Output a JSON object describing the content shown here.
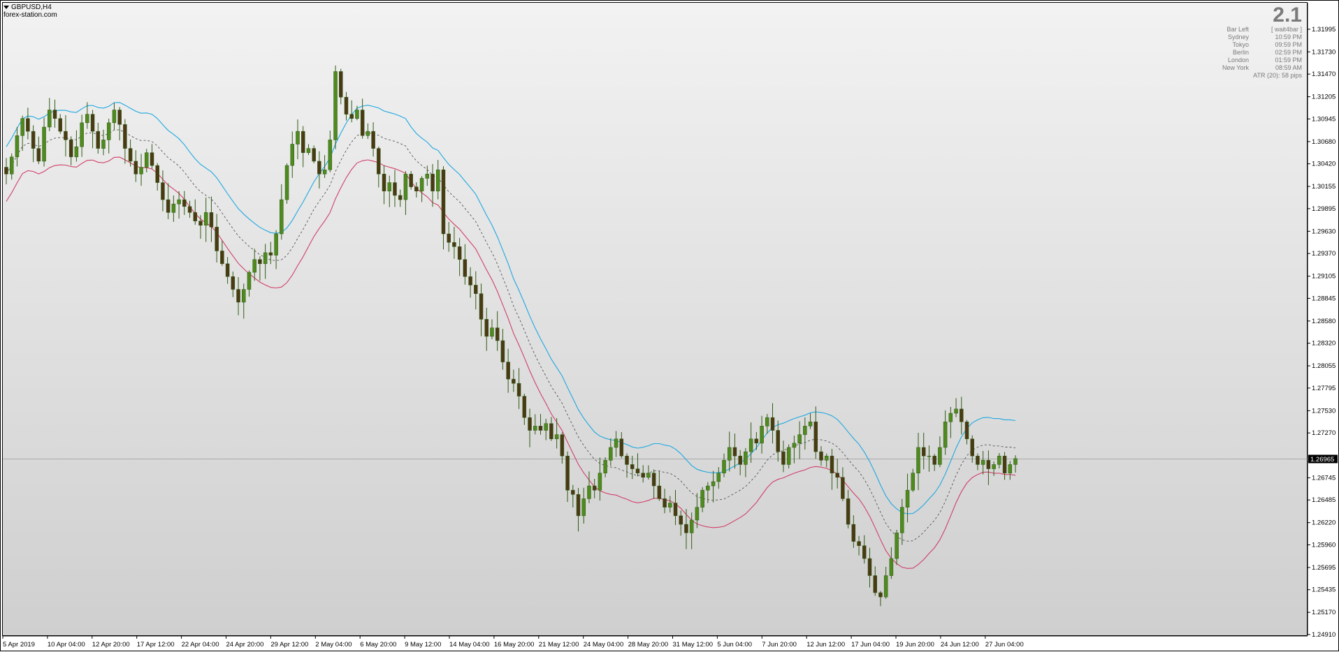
{
  "chart_header": {
    "symbol_label": "GBPUSD,H4",
    "source_label": "forex-station.com"
  },
  "info_panel": {
    "big_value": "2.1",
    "rows": [
      {
        "label": "Bar Left",
        "value": "[ wait4bar ]"
      },
      {
        "label": "Sydney",
        "value": "10:59 PM"
      },
      {
        "label": "Tokyo",
        "value": "09:59 PM"
      },
      {
        "label": "Berlin",
        "value": "02:59 PM"
      },
      {
        "label": "London",
        "value": "01:59 PM"
      },
      {
        "label": "New York",
        "value": "08:59 AM"
      }
    ],
    "atr": "ATR (20): 58 pips"
  },
  "colors": {
    "bull_body": "#4f8a1f",
    "bear_body": "#4a3a14",
    "wick": "#2f5a12",
    "upper_band": "#1ea8e0",
    "lower_band": "#d0406a",
    "middle_line": "#555555",
    "current_price_bg": "#000000"
  },
  "current_price": "1.26965",
  "chart_data": {
    "type": "candlestick",
    "symbol": "GBPUSD",
    "timeframe": "H4",
    "ylim": [
      1.2491,
      1.3219
    ],
    "price_ticks": [
      "1.31995",
      "1.31730",
      "1.31470",
      "1.31205",
      "1.30945",
      "1.30680",
      "1.30420",
      "1.30155",
      "1.29895",
      "1.29630",
      "1.29370",
      "1.29105",
      "1.28845",
      "1.28580",
      "1.28320",
      "1.28055",
      "1.27795",
      "1.27530",
      "1.27270",
      "1.26745",
      "1.26485",
      "1.26220",
      "1.25960",
      "1.25695",
      "1.25435",
      "1.25170",
      "1.24910"
    ],
    "time_ticks": [
      "5 Apr 2019",
      "10 Apr 04:00",
      "12 Apr 20:00",
      "17 Apr 12:00",
      "22 Apr 04:00",
      "24 Apr 20:00",
      "29 Apr 12:00",
      "2 May 04:00",
      "6 May 20:00",
      "9 May 12:00",
      "14 May 04:00",
      "16 May 20:00",
      "21 May 12:00",
      "24 May 04:00",
      "28 May 20:00",
      "31 May 12:00",
      "5 Jun 04:00",
      "7 Jun 20:00",
      "12 Jun 12:00",
      "17 Jun 04:00",
      "19 Jun 20:00",
      "24 Jun 12:00",
      "27 Jun 04:00"
    ],
    "close_path": [
      1.303,
      1.305,
      1.3075,
      1.3095,
      1.308,
      1.306,
      1.3045,
      1.3085,
      1.3105,
      1.3095,
      1.308,
      1.307,
      1.305,
      1.3062,
      1.309,
      1.31,
      1.308,
      1.306,
      1.307,
      1.309,
      1.3105,
      1.3088,
      1.306,
      1.3045,
      1.303,
      1.3038,
      1.3055,
      1.304,
      1.302,
      1.3,
      1.2985,
      1.2995,
      1.3,
      1.2992,
      1.2985,
      1.2975,
      1.297,
      1.2985,
      1.2968,
      1.294,
      1.2925,
      1.291,
      1.2895,
      1.288,
      1.2895,
      1.2915,
      1.293,
      1.2925,
      1.2938,
      1.2935,
      1.296,
      1.3,
      1.304,
      1.3065,
      1.308,
      1.3055,
      1.306,
      1.3045,
      1.303,
      1.3035,
      1.307,
      1.315,
      1.312,
      1.31,
      1.3095,
      1.3105,
      1.3075,
      1.308,
      1.306,
      1.303,
      1.301,
      1.302,
      1.3005,
      1.3,
      1.303,
      1.3015,
      1.301,
      1.3025,
      1.303,
      1.301,
      1.3035,
      1.296,
      1.295,
      1.2945,
      1.293,
      1.291,
      1.29,
      1.289,
      1.286,
      1.284,
      1.285,
      1.2835,
      1.281,
      1.279,
      1.2785,
      1.277,
      1.2745,
      1.273,
      1.2735,
      1.273,
      1.2738,
      1.272,
      1.2725,
      1.27,
      1.266,
      1.2655,
      1.263,
      1.265,
      1.2665,
      1.266,
      1.268,
      1.2695,
      1.271,
      1.272,
      1.27,
      1.269,
      1.2685,
      1.268,
      1.2675,
      1.268,
      1.2665,
      1.265,
      1.264,
      1.2645,
      1.263,
      1.262,
      1.261,
      1.2625,
      1.264,
      1.266,
      1.2665,
      1.267,
      1.268,
      1.2695,
      1.271,
      1.27,
      1.269,
      1.2705,
      1.272,
      1.2715,
      1.2735,
      1.2745,
      1.273,
      1.2705,
      1.269,
      1.271,
      1.2715,
      1.2725,
      1.2735,
      1.274,
      1.2705,
      1.2695,
      1.27,
      1.268,
      1.2675,
      1.265,
      1.262,
      1.26,
      1.2595,
      1.258,
      1.256,
      1.254,
      1.2535,
      1.256,
      1.258,
      1.261,
      1.264,
      1.266,
      1.268,
      1.271,
      1.27,
      1.27,
      1.269,
      1.271,
      1.274,
      1.275,
      1.2755,
      1.274,
      1.272,
      1.27,
      1.269,
      1.2695,
      1.2685,
      1.269,
      1.27,
      1.268,
      1.269,
      1.2697
    ]
  }
}
